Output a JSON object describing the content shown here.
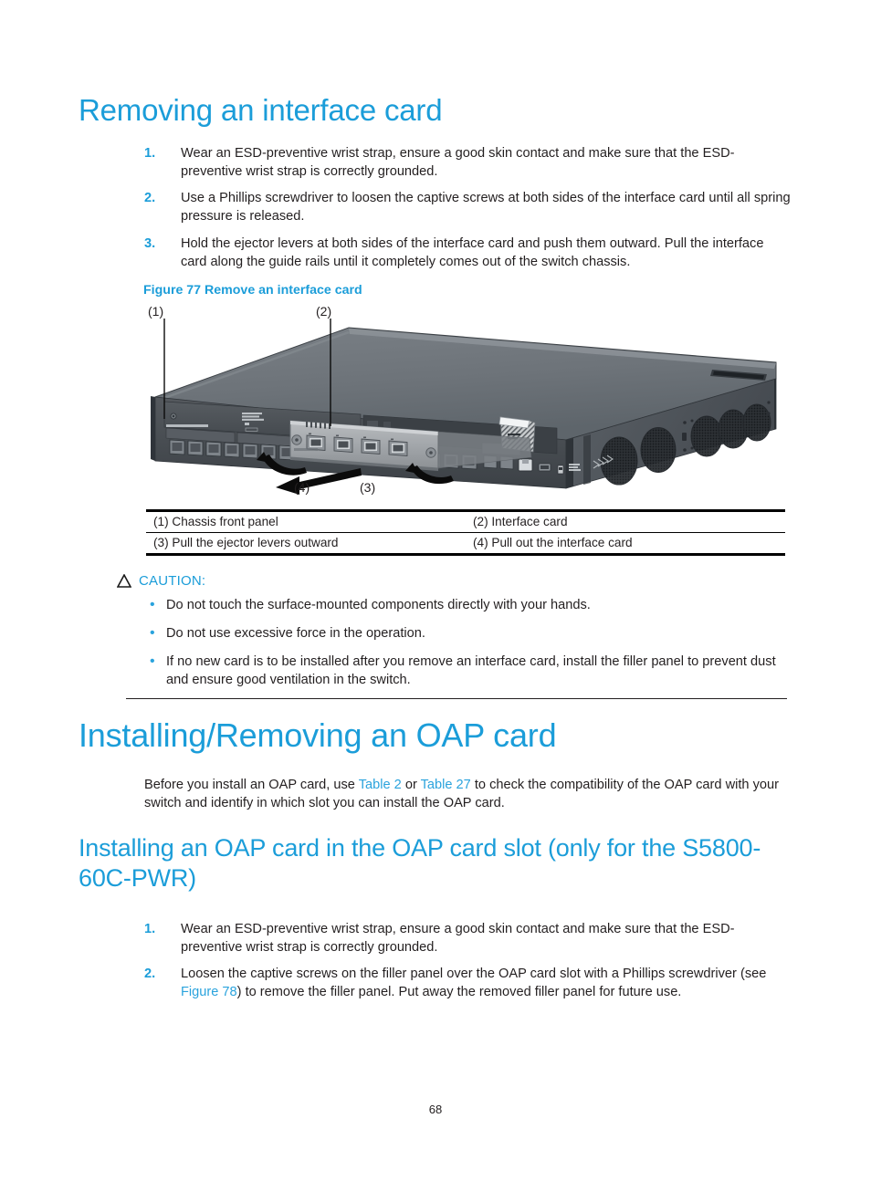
{
  "document": {
    "page_number": "68"
  },
  "section_removing": {
    "heading": "Removing an interface card",
    "steps": [
      {
        "number": "1.",
        "text": "Wear an ESD-preventive wrist strap, ensure a good skin contact and make sure that the ESD-preventive wrist strap is correctly grounded."
      },
      {
        "number": "2.",
        "text": "Use a Phillips screwdriver to loosen the captive screws at both sides of the interface card until all spring pressure is released."
      },
      {
        "number": "3.",
        "text": "Hold the ejector levers at both sides of the interface card and push them outward. Pull the interface card along the guide rails until it completely comes out of the switch chassis."
      }
    ]
  },
  "figure": {
    "caption": "Figure 77 Remove an interface card",
    "callouts": [
      {
        "id": "(1)",
        "label": "Chassis front panel"
      },
      {
        "id": "(2)",
        "label": "Interface card"
      },
      {
        "id": "(3)",
        "label": "Pull the ejector levers outward"
      },
      {
        "id": "(4)",
        "label": "Pull out the interface card"
      }
    ],
    "legend_rows": [
      {
        "left": "(1) Chassis front panel",
        "right": "(2) Interface card"
      },
      {
        "left": "(3) Pull the ejector levers outward",
        "right": "(4) Pull out the interface card"
      }
    ]
  },
  "caution": {
    "label": "CAUTION:",
    "icon": "warning-triangle-icon",
    "items": [
      "Do not touch the surface-mounted components directly with your hands.",
      "Do not use excessive force in the operation.",
      "If no new card is to be installed after you remove an interface card, install the filler panel to prevent dust and ensure good ventilation in the switch."
    ]
  },
  "section_oap": {
    "heading": "Installing/Removing an OAP card",
    "intro": {
      "before": "Before you install an OAP card, use ",
      "link1": "Table 2",
      "middle": " or ",
      "link2": "Table 27",
      "after": " to check the compatibility of the OAP card with your switch and identify in which slot you can install the OAP card."
    }
  },
  "section_installing_oap": {
    "heading": "Installing an OAP card in the OAP card slot (only for the S5800-60C-PWR)",
    "steps": [
      {
        "number": "1.",
        "text": "Wear an ESD-preventive wrist strap, ensure a good skin contact and make sure that the ESD-preventive wrist strap is correctly grounded."
      },
      {
        "number": "2.",
        "before": "Loosen the captive screws on the filler panel over the OAP card slot with a Phillips screwdriver (see ",
        "link": "Figure 78",
        "after": ") to remove the filler panel. Put away the removed filler panel for future use."
      }
    ]
  },
  "theme": {
    "accent_blue": "#1b9dd9",
    "link_blue": "#2aa3dd",
    "body_text": "#231f20"
  }
}
